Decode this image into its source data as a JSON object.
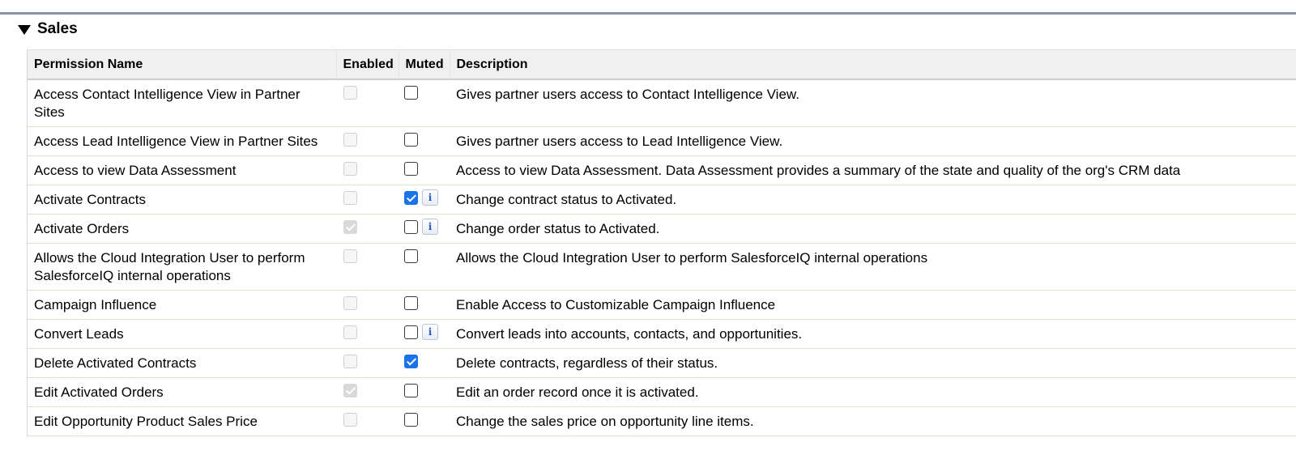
{
  "section": {
    "title": "Sales"
  },
  "table": {
    "headers": {
      "name": "Permission Name",
      "enabled": "Enabled",
      "muted": "Muted",
      "description": "Description"
    },
    "rows": [
      {
        "name": "Access Contact Intelligence View in Partner Sites",
        "enabled": false,
        "muted": false,
        "info": false,
        "description": "Gives partner users access to Contact Intelligence View."
      },
      {
        "name": "Access Lead Intelligence View in Partner Sites",
        "enabled": false,
        "muted": false,
        "info": false,
        "description": "Gives partner users access to Lead Intelligence View."
      },
      {
        "name": "Access to view Data Assessment",
        "enabled": false,
        "muted": false,
        "info": false,
        "description": "Access to view Data Assessment. Data Assessment provides a summary of the state and quality of the org's CRM data"
      },
      {
        "name": "Activate Contracts",
        "enabled": false,
        "muted": true,
        "info": true,
        "description": "Change contract status to Activated."
      },
      {
        "name": "Activate Orders",
        "enabled": true,
        "muted": false,
        "info": true,
        "description": "Change order status to Activated."
      },
      {
        "name": "Allows the Cloud Integration User to perform SalesforceIQ internal operations",
        "enabled": false,
        "muted": false,
        "info": false,
        "description": "Allows the Cloud Integration User to perform SalesforceIQ internal operations"
      },
      {
        "name": "Campaign Influence",
        "enabled": false,
        "muted": false,
        "info": false,
        "description": "Enable Access to Customizable Campaign Influence"
      },
      {
        "name": "Convert Leads",
        "enabled": false,
        "muted": false,
        "info": true,
        "description": "Convert leads into accounts, contacts, and opportunities."
      },
      {
        "name": "Delete Activated Contracts",
        "enabled": false,
        "muted": true,
        "info": false,
        "description": "Delete contracts, regardless of their status."
      },
      {
        "name": "Edit Activated Orders",
        "enabled": true,
        "muted": false,
        "info": false,
        "description": "Edit an order record once it is activated."
      },
      {
        "name": "Edit Opportunity Product Sales Price",
        "enabled": false,
        "muted": false,
        "info": false,
        "description": "Change the sales price on opportunity line items."
      }
    ]
  },
  "icons": {
    "info_glyph": "i",
    "collapse": "triangle-down-icon"
  },
  "colors": {
    "checked_accent": "#1a73e8",
    "header_bg": "#f0f0f0",
    "row_divider": "#dde3c8",
    "top_rule": "#8a93ad"
  }
}
